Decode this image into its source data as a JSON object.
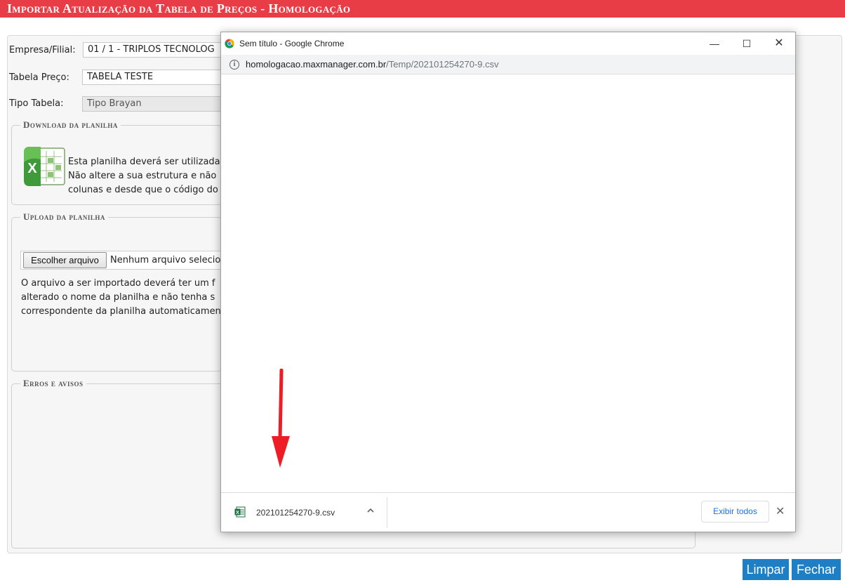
{
  "page": {
    "title": "Importar Atualização da Tabela de Preços  - Homologação"
  },
  "form": {
    "empresa_label": "Empresa/Filial:",
    "empresa_value": "01 / 1 - TRIPLOS TECNOLOG",
    "tabela_label": "Tabela Preço:",
    "tabela_value": "TABELA TESTE",
    "tipo_label": "Tipo Tabela:",
    "tipo_value": "Tipo Brayan"
  },
  "download_section": {
    "legend": "Download da planilha",
    "line1": "Esta planilha deverá ser utilizada",
    "line2": "Não altere a sua estrutura e não",
    "line3": "colunas e desde que o código do"
  },
  "upload_section": {
    "legend": "Upload da planilha",
    "choose_button": "Escolher arquivo",
    "no_file": "Nenhum arquivo selecio",
    "line1": "O arquivo a ser importado deverá ter um f",
    "line2": "alterado o nome da planilha e não tenha s",
    "line3": "correspondente da planilha automaticamen"
  },
  "errors_section": {
    "legend": "Erros e avisos"
  },
  "actions": {
    "clear": "Limpar",
    "close": "Fechar"
  },
  "chrome": {
    "window_title": "Sem título - Google Chrome",
    "url_host": "homologacao.maxmanager.com.br",
    "url_path": "/Temp/202101254270-9.csv",
    "download_filename": "202101254270-9.csv",
    "show_all": "Exibir todos"
  },
  "colors": {
    "title_bar": "#e83c46",
    "action_button": "#1f7fc4",
    "arrow": "#ee1c25",
    "chrome_link": "#1a73e8"
  }
}
